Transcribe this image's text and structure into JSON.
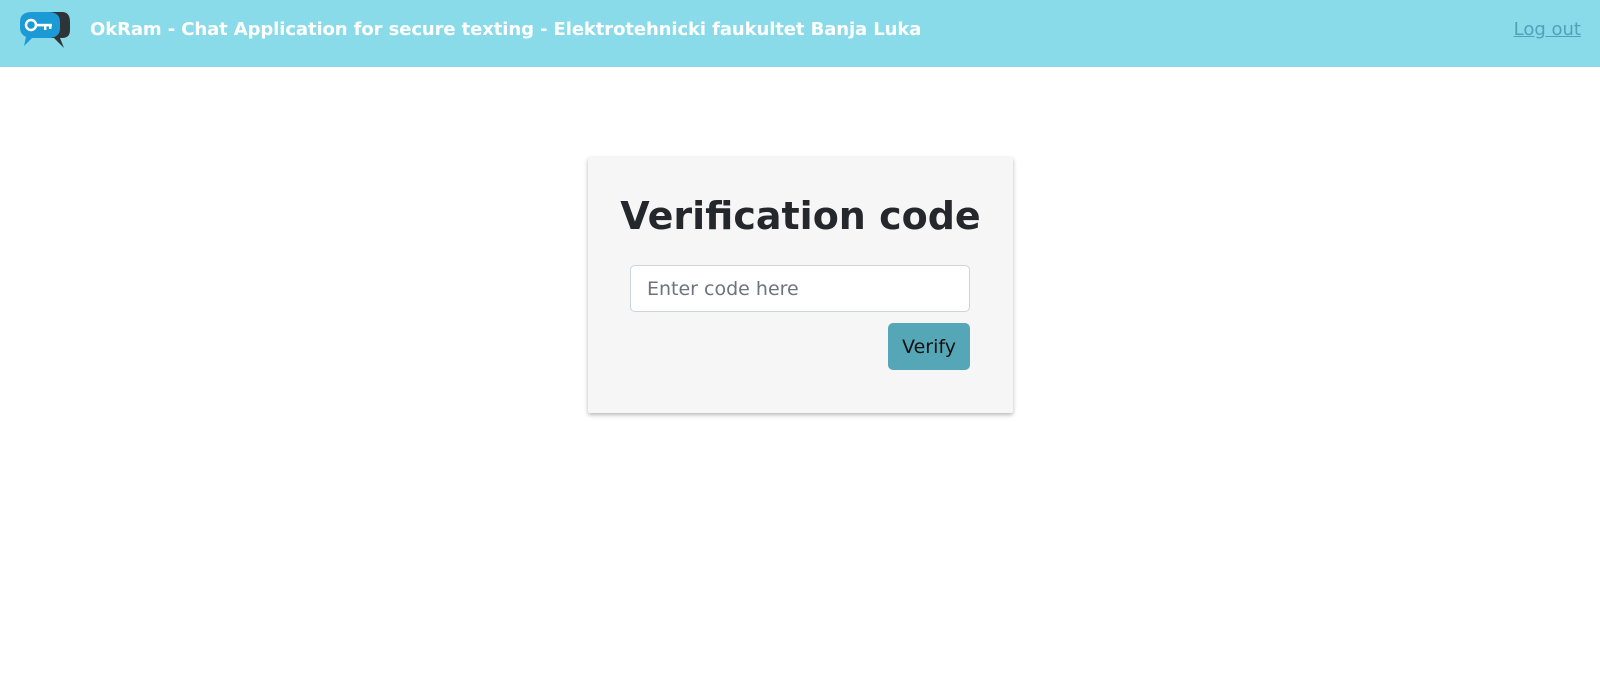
{
  "header": {
    "logo_icon": "chat-key-logo-icon",
    "brand_text": "OkRam - Chat Application for secure texting - Elektrotehnicki faukultet Banja Luka",
    "logout_label": "Log out",
    "background_color": "#8adbe9",
    "logout_color": "#4fa2b8"
  },
  "verification": {
    "title": "Verification code",
    "input_placeholder": "Enter code here",
    "input_value": "",
    "verify_label": "Verify",
    "button_color": "#55a7b7",
    "card_color": "#f6f6f6"
  }
}
